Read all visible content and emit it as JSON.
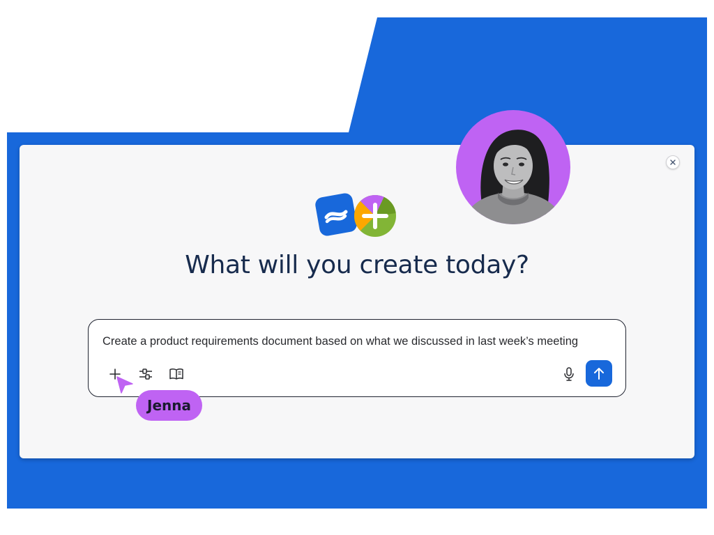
{
  "dialog": {
    "heading": "What will you create today?",
    "close_icon": "close-icon",
    "logo_icons": [
      "confluence-logo-icon",
      "plus-badge-icon"
    ]
  },
  "prompt": {
    "text": "Create a product requirements document based on what we discussed in last week’s meeting",
    "tools": [
      "plus-icon",
      "sliders-icon",
      "book-icon"
    ],
    "mic_icon": "microphone-icon",
    "send_icon": "arrow-up-icon"
  },
  "collaborator": {
    "name": "Jenna",
    "cursor_icon": "pointer-cursor-icon"
  },
  "colors": {
    "brand_blue": "#1868db",
    "cursor_purple": "#bf63f3",
    "card_bg": "#f7f7f8"
  }
}
